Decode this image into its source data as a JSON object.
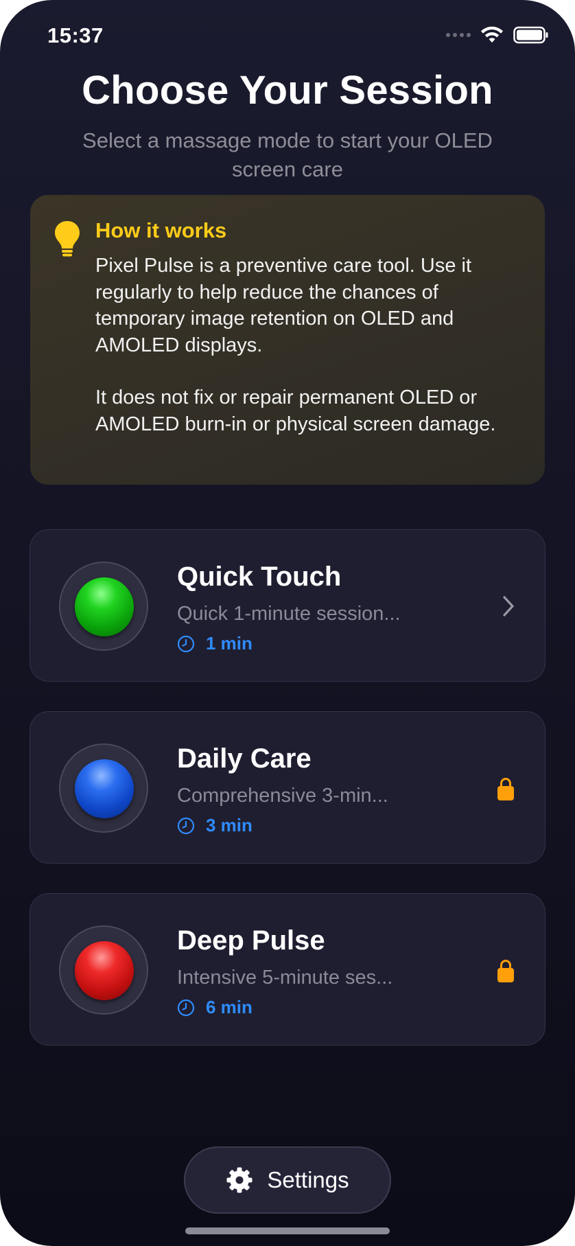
{
  "status_bar": {
    "time": "15:37"
  },
  "header": {
    "title": "Choose Your Session",
    "subtitle": "Select a massage mode to start your OLED screen care"
  },
  "info": {
    "icon": "lightbulb-icon",
    "title": "How it works",
    "paragraph1": "Pixel Pulse is a preventive care tool. Use it regularly to help reduce the chances of temporary image retention on OLED and AMOLED displays.",
    "paragraph2": "It does not fix or repair permanent OLED or AMOLED burn-in or physical screen damage.",
    "title_color": "#FFCC1A"
  },
  "sessions": [
    {
      "title": "Quick Touch",
      "description": "Quick 1-minute session...",
      "duration": "1 min",
      "orb_color": "green",
      "locked": false,
      "trailing_icon": "chevron-right-icon"
    },
    {
      "title": "Daily Care",
      "description": "Comprehensive 3-min...",
      "duration": "3 min",
      "orb_color": "blue",
      "locked": true,
      "trailing_icon": "lock-icon"
    },
    {
      "title": "Deep Pulse",
      "description": "Intensive 5-minute ses...",
      "duration": "6 min",
      "orb_color": "red",
      "locked": true,
      "trailing_icon": "lock-icon"
    }
  ],
  "footer": {
    "settings_label": "Settings",
    "settings_icon": "gear-icon"
  },
  "colors": {
    "accent_blue": "#2F8CFF",
    "lock_orange": "#FF9F0A",
    "info_yellow": "#FFCC1A",
    "background": "#151526"
  }
}
